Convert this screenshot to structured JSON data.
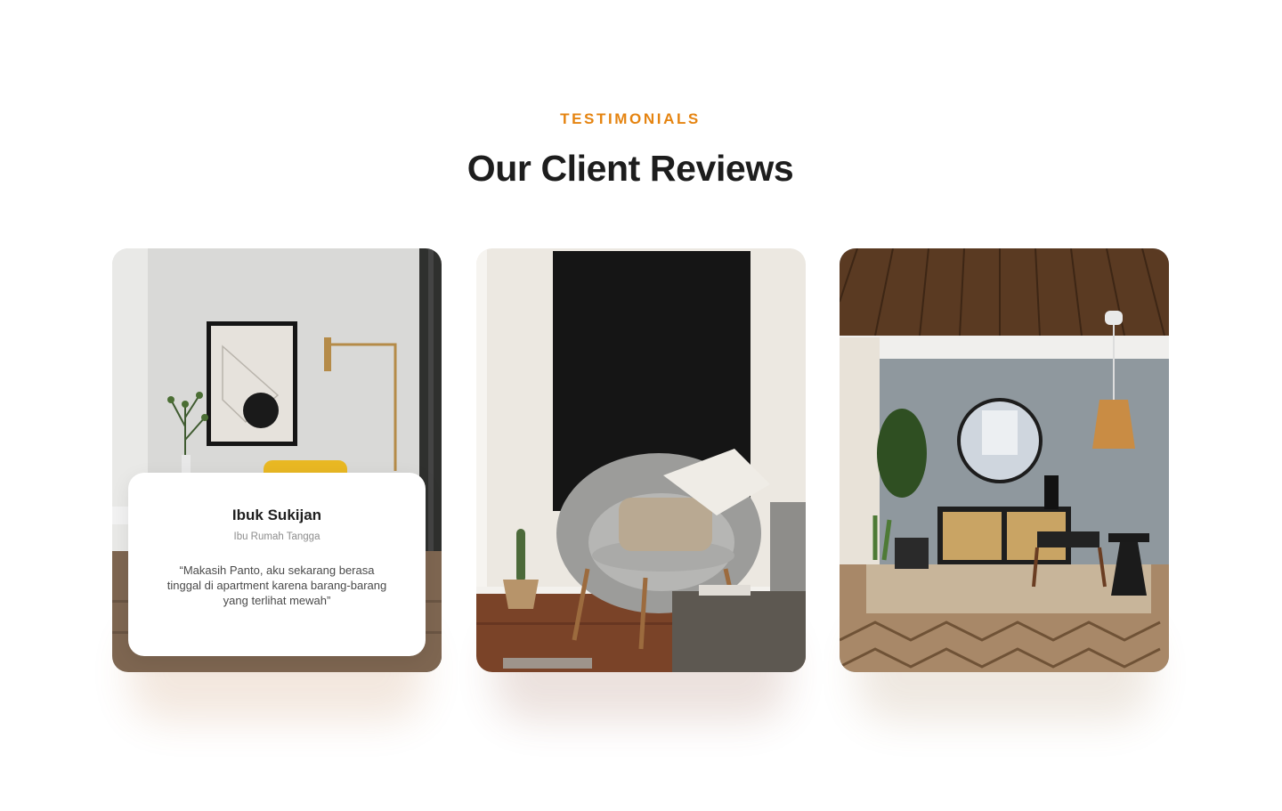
{
  "section": {
    "eyebrow": "TESTIMONIALS",
    "title": "Our Client Reviews",
    "accent_color": "#E58411"
  },
  "testimonials": [
    {
      "photo": "living-room-yellow-chair",
      "name": "Ibuk Sukijan",
      "role": "Ibu Rumah Tangga",
      "quote": "“Makasih Panto, aku sekarang berasa tinggal di apartment karena barang-barang yang terlihat mewah”"
    },
    {
      "photo": "grey-lounge-chair-black-canvas"
    },
    {
      "photo": "wood-ceiling-round-mirror-room"
    }
  ]
}
